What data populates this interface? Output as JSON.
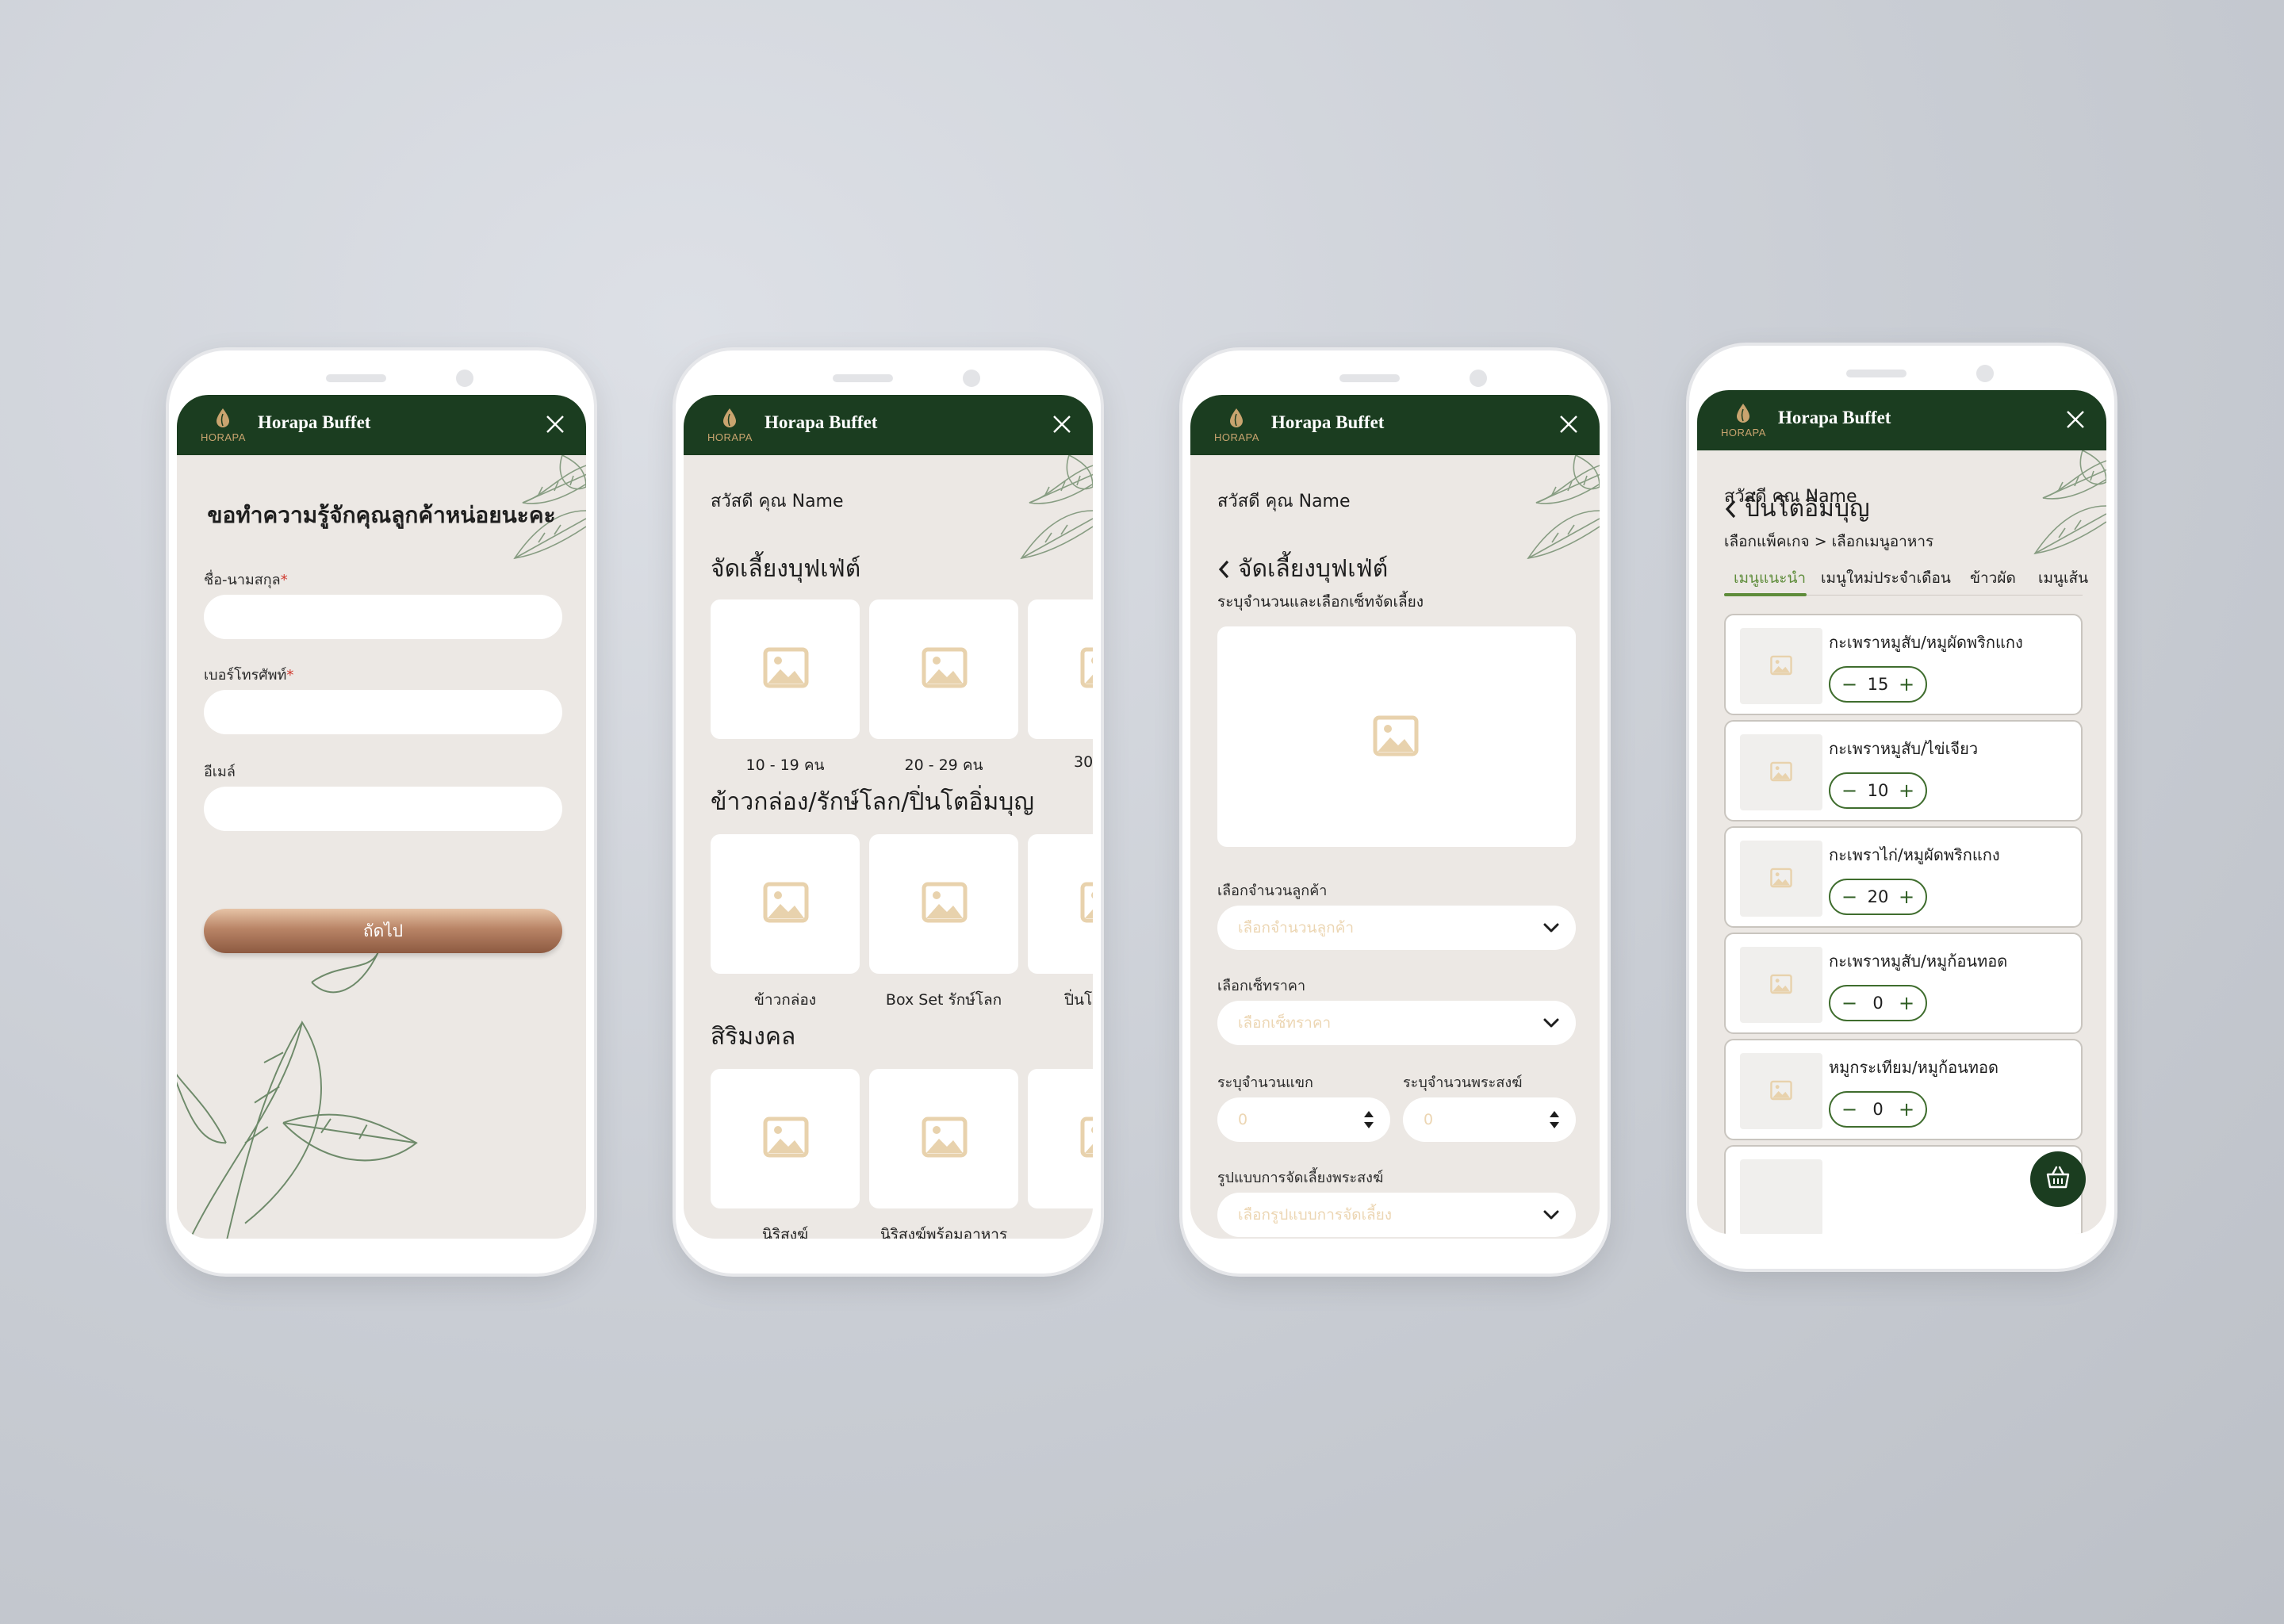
{
  "app": {
    "title": "Horapa Buffet",
    "brand": "HORAPA"
  },
  "colors": {
    "header": "#1b3d20",
    "accent_green": "#5e8c3a",
    "cta": "#b98466",
    "screen_bg": "#ece8e4",
    "placeholder": "#ecd6b3"
  },
  "greeting": "สวัสดี คุณ Name",
  "screen1": {
    "heading": "ขอทำความรู้จักคุณลูกค้าหน่อยนะคะ",
    "name_label": "ชื่อ-นามสกุล",
    "phone_label": "เบอร์โทรศัพท์",
    "email_label": "อีเมล์",
    "required_mark": "*",
    "next_button": "ถัดไป"
  },
  "screen2": {
    "sections": [
      {
        "title": "จัดเลี้ยงบุฟเฟ่ต์",
        "items": [
          "10 - 19 คน",
          "20 - 29 คน",
          "30"
        ]
      },
      {
        "title": "ข้าวกล่อง/รักษ์โลก/ปิ่นโตอิ่มบุญ",
        "items": [
          "ข้าวกล่อง",
          "Box Set รักษ์โลก",
          "ปิ่นโต"
        ]
      },
      {
        "title": "สิริมงคล",
        "items": [
          "นิริสงฆ์",
          "นิริสงฆ์พร้อมอาหาร",
          ""
        ]
      }
    ]
  },
  "screen3": {
    "title": "จัดเลี้ยงบุฟเฟ่ต์",
    "subtitle": "ระบุจำนวนและเลือกเซ็ทจัดเลี้ยง",
    "guests_label": "เลือกจำนวนลูกค้า",
    "guests_placeholder": "เลือกจำนวนลูกค้า",
    "price_label": "เลือกเซ็ทราคา",
    "price_placeholder": "เลือกเซ็ทราคา",
    "visitors_label": "ระบุจำนวนแขก",
    "visitors_value": "0",
    "monks_label": "ระบุจำนวนพระสงฆ์",
    "monks_value": "0",
    "style_label": "รูปแบบการจัดเลี้ยงพระสงฆ์",
    "style_placeholder": "เลือกรูปแบบการจัดเลี้ยง"
  },
  "screen4": {
    "title": "ปิ่นโตอิ่มบุญ",
    "breadcrumb": "เลือกแพ็คเกจ > เลือกเมนูอาหาร",
    "tabs": [
      "เมนูแนะนำ",
      "เมนูใหม่ประจำเดือน",
      "ข้าวผัด",
      "เมนูเส้น"
    ],
    "items": [
      {
        "name": "กะเพราหมูสับ/หมูผัดพริกแกง",
        "qty": "15"
      },
      {
        "name": "กะเพราหมูสับ/ไข่เจียว",
        "qty": "10"
      },
      {
        "name": "กะเพราไก่/หมูผัดพริกแกง",
        "qty": "20"
      },
      {
        "name": "กะเพราหมูสับ/หมูก้อนทอด",
        "qty": "0"
      },
      {
        "name": "หมูกระเทียม/หมูก้อนทอด",
        "qty": "0"
      }
    ],
    "minus": "−",
    "plus": "+"
  },
  "icons": {
    "close": "close-icon",
    "image": "image-placeholder-icon",
    "chevron": "chevron-down-icon",
    "back": "chevron-left-icon",
    "cart": "basket-icon"
  }
}
